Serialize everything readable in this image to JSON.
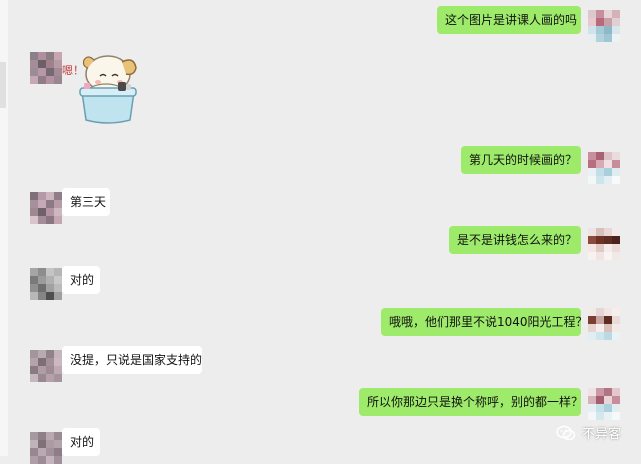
{
  "messages": [
    {
      "side": "out",
      "type": "text",
      "text": "这个图片是讲课人画的吗"
    },
    {
      "side": "in",
      "type": "sticker",
      "sticker_text": "嗯！"
    },
    {
      "side": "out",
      "type": "text",
      "text": "第几天的时候画的？"
    },
    {
      "side": "in",
      "type": "text",
      "text": "第三天"
    },
    {
      "side": "out",
      "type": "text",
      "text": "是不是讲钱怎么来的？"
    },
    {
      "side": "in",
      "type": "text",
      "text": "对的"
    },
    {
      "side": "out",
      "type": "text",
      "text": "哦哦，他们那里不说1040阳光工程？"
    },
    {
      "side": "in",
      "type": "text",
      "text": "没提，只说是国家支持的"
    },
    {
      "side": "out",
      "type": "text",
      "text": "所以你那边只是换个称呼，别的都一样？"
    },
    {
      "side": "in",
      "type": "text",
      "text": "对的"
    }
  ],
  "watermark": {
    "text": "不异客",
    "icon": "wechat-icon"
  },
  "colors": {
    "background": "#ededed",
    "bubble_out": "#9eea6a",
    "bubble_in": "#ffffff"
  }
}
